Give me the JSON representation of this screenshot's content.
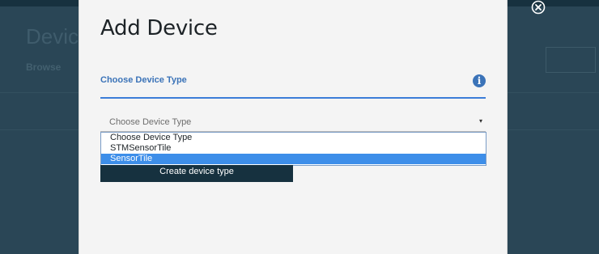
{
  "background": {
    "title": "Devic",
    "browse_label": "Browse"
  },
  "modal": {
    "title": "Add Device",
    "section_label": "Choose Device Type",
    "info_icon": "i",
    "select": {
      "value": "Choose Device Type",
      "arrow": "▾"
    },
    "options": [
      "Choose Device Type",
      "STMSensorTile",
      "SensorTile"
    ],
    "selected_option": "SensorTile",
    "create_button_label": "Create device type"
  },
  "icons": {
    "close": "close-circle-icon",
    "info": "info-icon",
    "dropdown_arrow": "chevron-down-icon"
  },
  "colors": {
    "accent": "#3b7dd8",
    "selected_option_bg": "#3d8ee9",
    "button_bg": "#16313f",
    "overlay": "#2a4656"
  }
}
